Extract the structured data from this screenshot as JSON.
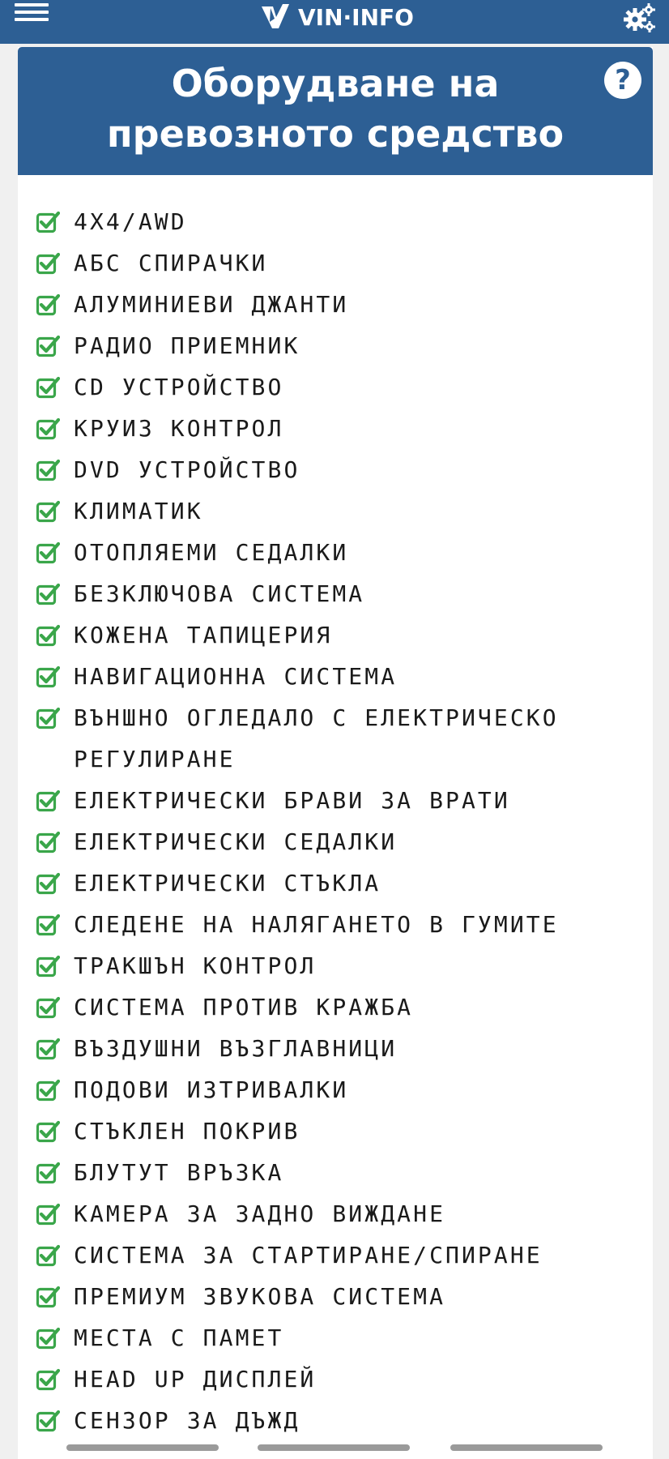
{
  "topbar": {
    "logo_text": "VIN·INFO",
    "menu_icon": "hamburger-menu-icon",
    "settings_icon": "gears-icon"
  },
  "card": {
    "title": "Оборудване на превозното средство",
    "help_icon": "question-circle-icon",
    "help_glyph": "?"
  },
  "equipment": [
    "4X4/AWD",
    "АБС СПИРАЧКИ",
    "АЛУМИНИЕВИ ДЖАНТИ",
    "РАДИО ПРИЕМНИК",
    "CD УСТРОЙСТВО",
    "КРУИЗ КОНТРОЛ",
    "DVD УСТРОЙСТВО",
    "КЛИМАТИК",
    "ОТОПЛЯЕМИ СЕДАЛКИ",
    "БЕЗКЛЮЧОВА СИСТЕМА",
    "КОЖЕНА ТАПИЦЕРИЯ",
    "НАВИГАЦИОННА СИСТЕМА",
    "ВЪНШНО ОГЛЕДАЛО С ЕЛЕКТРИЧЕСКО РЕГУЛИРАНЕ",
    "ЕЛЕКТРИЧЕСКИ БРАВИ ЗА ВРАТИ",
    "ЕЛЕКТРИЧЕСКИ СЕДАЛКИ",
    "ЕЛЕКТРИЧЕСКИ СТЪКЛА",
    "СЛЕДЕНЕ НА НАЛЯГАНЕТО В ГУМИТЕ",
    "ТРАКШЪН КОНТРОЛ",
    "СИСТЕМА ПРОТИВ КРАЖБА",
    "ВЪЗДУШНИ ВЪЗГЛАВНИЦИ",
    "ПОДОВИ ИЗТРИВАЛКИ",
    "СТЪКЛЕН ПОКРИВ",
    "БЛУТУТ ВРЪЗКА",
    "КАМЕРА ЗА ЗАДНО ВИЖДАНЕ",
    "СИСТЕМА ЗА СТАРТИРАНЕ/СПИРАНЕ",
    "ПРЕМИУМ ЗВУКОВА СИСТЕМА",
    "МЕСТА С ПАМЕТ",
    "HEAD UP ДИСПЛЕЙ",
    "СЕНЗОР ЗА ДЪЖД"
  ],
  "item_icon": "check-square-icon",
  "colors": {
    "header_blue": "#2d5f94",
    "check_green": "#3aa64a"
  }
}
